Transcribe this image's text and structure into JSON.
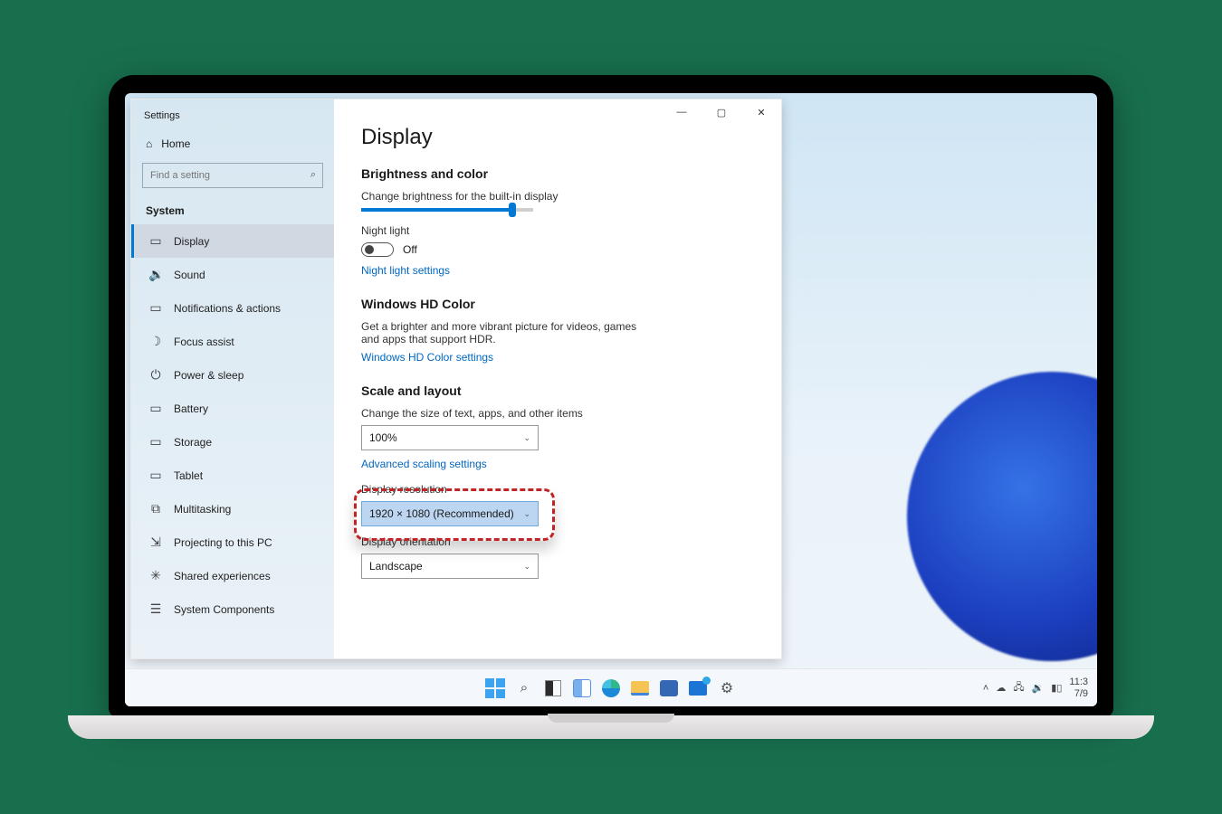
{
  "window": {
    "title": "Settings",
    "controls": {
      "min": "—",
      "max": "▢",
      "close": "✕"
    }
  },
  "sidebar": {
    "home": "Home",
    "searchPlaceholder": "Find a setting",
    "category": "System",
    "items": [
      {
        "icon": "display-icon",
        "glyph": "▭",
        "label": "Display"
      },
      {
        "icon": "sound-icon",
        "glyph": "🔉",
        "label": "Sound"
      },
      {
        "icon": "notification-icon",
        "glyph": "▭",
        "label": "Notifications & actions"
      },
      {
        "icon": "focus-icon",
        "glyph": "☽",
        "label": "Focus assist"
      },
      {
        "icon": "power-icon",
        "glyph": "⏻",
        "label": "Power & sleep"
      },
      {
        "icon": "battery-icon",
        "glyph": "▭",
        "label": "Battery"
      },
      {
        "icon": "storage-icon",
        "glyph": "▭",
        "label": "Storage"
      },
      {
        "icon": "tablet-icon",
        "glyph": "▭",
        "label": "Tablet"
      },
      {
        "icon": "multitask-icon",
        "glyph": "⧉",
        "label": "Multitasking"
      },
      {
        "icon": "projecting-icon",
        "glyph": "⇲",
        "label": "Projecting to this PC"
      },
      {
        "icon": "shared-icon",
        "glyph": "✳",
        "label": "Shared experiences"
      },
      {
        "icon": "components-icon",
        "glyph": "☰",
        "label": "System Components"
      }
    ],
    "selectedIndex": 0
  },
  "content": {
    "pageTitle": "Display",
    "brightness": {
      "heading": "Brightness and color",
      "sliderLabel": "Change brightness for the built-in display",
      "nightLightLabel": "Night light",
      "nightLightState": "Off",
      "nightLightSettings": "Night light settings"
    },
    "hdcolor": {
      "heading": "Windows HD Color",
      "desc": "Get a brighter and more vibrant picture for videos, games and apps that support HDR.",
      "link": "Windows HD Color settings"
    },
    "scale": {
      "heading": "Scale and layout",
      "sizeLabel": "Change the size of text, apps, and other items",
      "sizeValue": "100%",
      "advanced": "Advanced scaling settings",
      "resolutionLabel": "Display resolution",
      "resolutionValue": "1920 × 1080 (Recommended)",
      "orientationLabel": "Display orientation",
      "orientationValue": "Landscape"
    }
  },
  "taskbar": {
    "trayTime": "11:3",
    "trayDate": "7/9"
  }
}
